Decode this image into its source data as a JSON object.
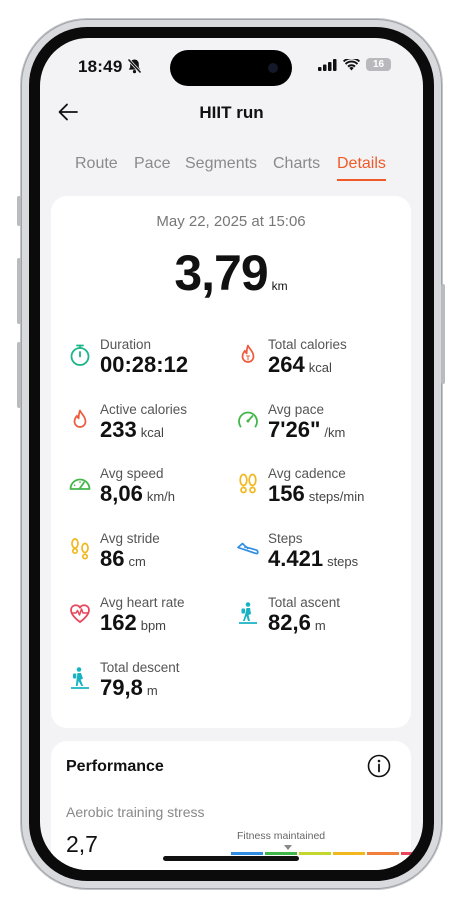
{
  "status_bar": {
    "time": "18:49",
    "battery": "16"
  },
  "header": {
    "title": "HIIT run"
  },
  "tabs": [
    "Route",
    "Pace",
    "Segments",
    "Charts",
    "Details"
  ],
  "active_tab": "Details",
  "summary": {
    "date": "May 22, 2025 at 15:06",
    "distance": "3,79",
    "distance_unit": "km"
  },
  "metrics": [
    {
      "label": "Duration",
      "value": "00:28:12",
      "unit": "",
      "icon": "stopwatch-icon",
      "color": "#1ab68a"
    },
    {
      "label": "Total calories",
      "value": "264",
      "unit": "kcal",
      "icon": "calorie-flame-icon",
      "color": "#ef5a3c"
    },
    {
      "label": "Active calories",
      "value": "233",
      "unit": "kcal",
      "icon": "flame-icon",
      "color": "#ef5a3c"
    },
    {
      "label": "Avg pace",
      "value": "7'26\"",
      "unit": "/km",
      "icon": "pace-gauge-icon",
      "color": "#43b649"
    },
    {
      "label": "Avg speed",
      "value": "8,06",
      "unit": "km/h",
      "icon": "speedometer-icon",
      "color": "#43b649"
    },
    {
      "label": "Avg cadence",
      "value": "156",
      "unit": "steps/min",
      "icon": "footprints-icon",
      "color": "#f2b71c"
    },
    {
      "label": "Avg stride",
      "value": "86",
      "unit": "cm",
      "icon": "footprints-icon",
      "color": "#f2b71c"
    },
    {
      "label": "Steps",
      "value": "4.421",
      "unit": "steps",
      "icon": "shoe-icon",
      "color": "#2f8de4"
    },
    {
      "label": "Avg heart rate",
      "value": "162",
      "unit": "bpm",
      "icon": "heart-rate-icon",
      "color": "#e8465c"
    },
    {
      "label": "Total ascent",
      "value": "82,6",
      "unit": "m",
      "icon": "hiker-ascent-icon",
      "color": "#17b3c2"
    },
    {
      "label": "Total descent",
      "value": "79,8",
      "unit": "m",
      "icon": "hiker-descent-icon",
      "color": "#17b3c2"
    }
  ],
  "performance": {
    "title": "Performance",
    "aerobic_label": "Aerobic training stress",
    "aerobic_value": "2,7",
    "fitness_status": "Fitness maintained",
    "scale_colors": [
      "#2f8de4",
      "#43b649",
      "#c3d62c",
      "#f2b71c",
      "#f3803a",
      "#e8465c"
    ]
  },
  "colors": {
    "accent": "#f05a28"
  }
}
